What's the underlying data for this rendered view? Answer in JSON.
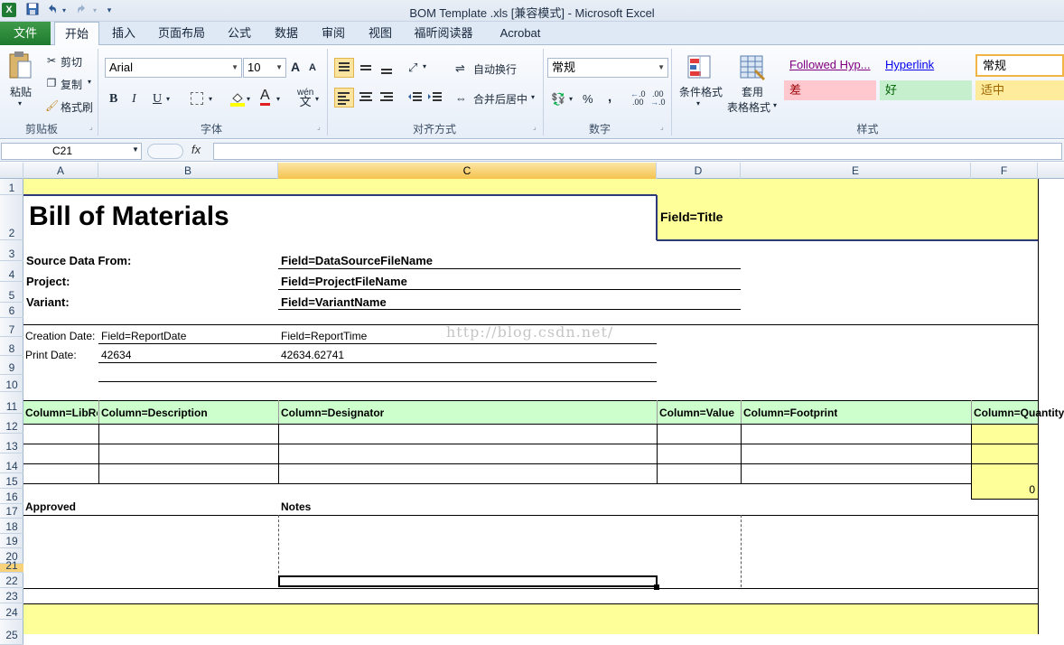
{
  "window": {
    "title": "BOM Template .xls  [兼容模式] - Microsoft Excel",
    "app_icon": "X"
  },
  "quick_access": {
    "save_icon": "save-icon",
    "undo_icon": "undo-icon",
    "redo_icon": "redo-icon"
  },
  "tabs": [
    "文件",
    "开始",
    "插入",
    "页面布局",
    "公式",
    "数据",
    "审阅",
    "视图",
    "福昕阅读器",
    "Acrobat"
  ],
  "ribbon": {
    "clipboard": {
      "paste": "粘贴",
      "cut": "剪切",
      "copy": "复制",
      "format_painter": "格式刷",
      "label": "剪贴板"
    },
    "font": {
      "name": "Arial",
      "size": "10",
      "grow": "A",
      "shrink": "A",
      "bold": "B",
      "italic": "I",
      "underline": "U",
      "font_color_icon": "A",
      "wen": "wén",
      "label": "字体"
    },
    "alignment": {
      "wrap": "自动换行",
      "merge": "合并后居中",
      "label": "对齐方式"
    },
    "number": {
      "format": "常规",
      "percent": "%",
      "comma": ",",
      "inc_dec": ".0",
      "dec_dec": ".00",
      "label": "数字"
    },
    "styles": {
      "cond_format": "条件格式",
      "table_format_1": "套用",
      "table_format_2": "表格格式",
      "followed": "Followed Hyp...",
      "hyperlink": "Hyperlink",
      "normal": "常规",
      "bad": "差",
      "good": "好",
      "neutral": "适中",
      "label": "样式"
    }
  },
  "formula_bar": {
    "name_box": "C21",
    "fx": "fx",
    "formula": ""
  },
  "columns": [
    "A",
    "B",
    "C",
    "D",
    "E",
    "F"
  ],
  "rows": [
    "1",
    "2",
    "3",
    "4",
    "5",
    "6",
    "7",
    "8",
    "9",
    "10",
    "11",
    "12",
    "13",
    "14",
    "15",
    "16",
    "17",
    "18",
    "19",
    "20",
    "21",
    "22",
    "23",
    "24",
    "25"
  ],
  "sheet": {
    "title": "Bill of Materials",
    "field_title": "Field=Title",
    "source_label": "Source Data From:",
    "source_value": "Field=DataSourceFileName",
    "project_label": "Project:",
    "project_value": "Field=ProjectFileName",
    "variant_label": "Variant:",
    "variant_value": "Field=VariantName",
    "creation_label": "Creation Date:",
    "creation_date": "Field=ReportDate",
    "creation_time": "Field=ReportTime",
    "print_label": "Print Date:",
    "print_date": "42634",
    "print_time": "42634.62741",
    "headers": [
      "Column=LibRe",
      "Column=Description",
      "Column=Designator",
      "Column=Value",
      "Column=Footprint",
      "Column=Quantity"
    ],
    "quantity_total": "0",
    "approved": "Approved",
    "notes": "Notes"
  },
  "watermark": "http://blog.csdn.net/"
}
